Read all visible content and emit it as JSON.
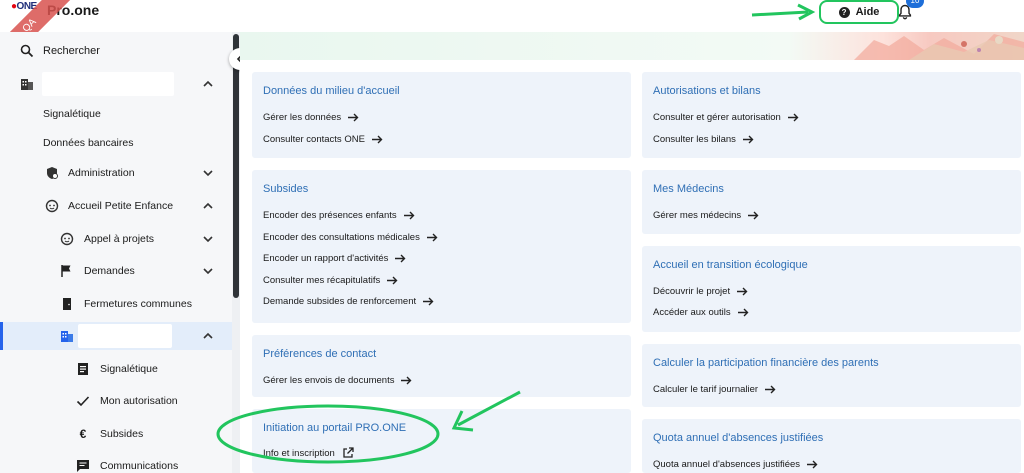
{
  "header": {
    "app_title": "Pro.one",
    "logo_text": "ONE",
    "env_ribbon": "QA",
    "help_label": "Aide",
    "notification_count": "10"
  },
  "sidebar": {
    "search_label": "Rechercher",
    "items": [
      {
        "label": "Signalétique"
      },
      {
        "label": "Données bancaires"
      },
      {
        "label": "Administration"
      },
      {
        "label": "Accueil Petite Enfance"
      },
      {
        "label": "Appel à projets"
      },
      {
        "label": "Demandes"
      },
      {
        "label": "Fermetures communes"
      },
      {
        "label": "Signalétique"
      },
      {
        "label": "Mon autorisation"
      },
      {
        "label": "Subsides"
      },
      {
        "label": "Communications"
      }
    ]
  },
  "cards": {
    "donnees": {
      "title": "Données du milieu d'accueil",
      "links": [
        "Gérer les données",
        "Consulter contacts ONE"
      ]
    },
    "autorisations": {
      "title": "Autorisations et bilans",
      "links": [
        "Consulter et gérer autorisation",
        "Consulter les bilans"
      ]
    },
    "subsides": {
      "title": "Subsides",
      "links": [
        "Encoder des présences enfants",
        "Encoder des consultations médicales",
        "Encoder un rapport d'activités",
        "Consulter mes récapitulatifs",
        "Demande subsides de renforcement"
      ]
    },
    "medecins": {
      "title": "Mes Médecins",
      "links": [
        "Gérer mes médecins"
      ]
    },
    "transition": {
      "title": "Accueil en transition écologique",
      "links": [
        "Découvrir le projet",
        "Accéder aux outils"
      ]
    },
    "preferences": {
      "title": "Préférences de contact",
      "links": [
        "Gérer les envois de documents"
      ]
    },
    "participation": {
      "title": "Calculer la participation financière des parents",
      "links": [
        "Calculer le tarif journalier"
      ]
    },
    "initiation": {
      "title": "Initiation au portail PRO.ONE",
      "links": [
        "Info et inscription"
      ]
    },
    "quota": {
      "title": "Quota annuel d'absences justifiées",
      "links": [
        "Quota annuel d'absences justifiées"
      ]
    }
  },
  "colors": {
    "accent": "#2563eb",
    "card_title": "#2f6fb5",
    "card_bg": "#eef3fa",
    "annotation": "#22c55e"
  }
}
